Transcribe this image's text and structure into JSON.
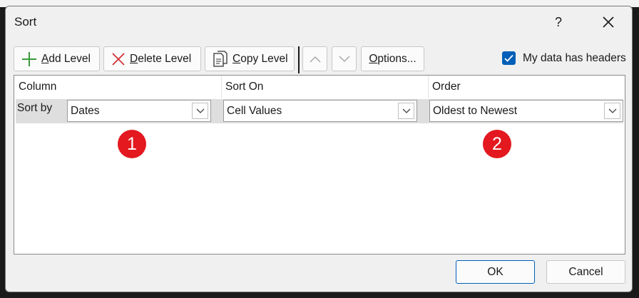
{
  "dialog": {
    "title": "Sort",
    "help_label": "?",
    "close_icon": "close-icon"
  },
  "toolbar": {
    "add_level": {
      "icon": "plus-icon",
      "accel": "A",
      "rest": "dd Level"
    },
    "delete_level": {
      "icon": "x-icon",
      "accel": "D",
      "rest": "elete Level"
    },
    "copy_level": {
      "icon": "copy-icon",
      "accel": "C",
      "rest": "opy Level"
    },
    "move_up_icon": "chevron-up-icon",
    "move_down_icon": "chevron-down-icon",
    "options": {
      "accel": "O",
      "rest": "ptions..."
    },
    "headers": {
      "before": "My data has ",
      "accel": "h",
      "rest": "eaders",
      "checked": true
    }
  },
  "grid": {
    "columns": [
      "Column",
      "Sort On",
      "Order"
    ],
    "rows": [
      {
        "label": "Sort by",
        "column": "Dates",
        "sort_on": "Cell Values",
        "order": "Oldest to Newest"
      }
    ]
  },
  "markers": [
    "1",
    "2"
  ],
  "footer": {
    "ok": "OK",
    "cancel": "Cancel"
  },
  "colors": {
    "accent": "#005fb8",
    "marker": "#e3191f",
    "add_icon": "#3a9a3a",
    "delete_icon": "#d13438"
  }
}
